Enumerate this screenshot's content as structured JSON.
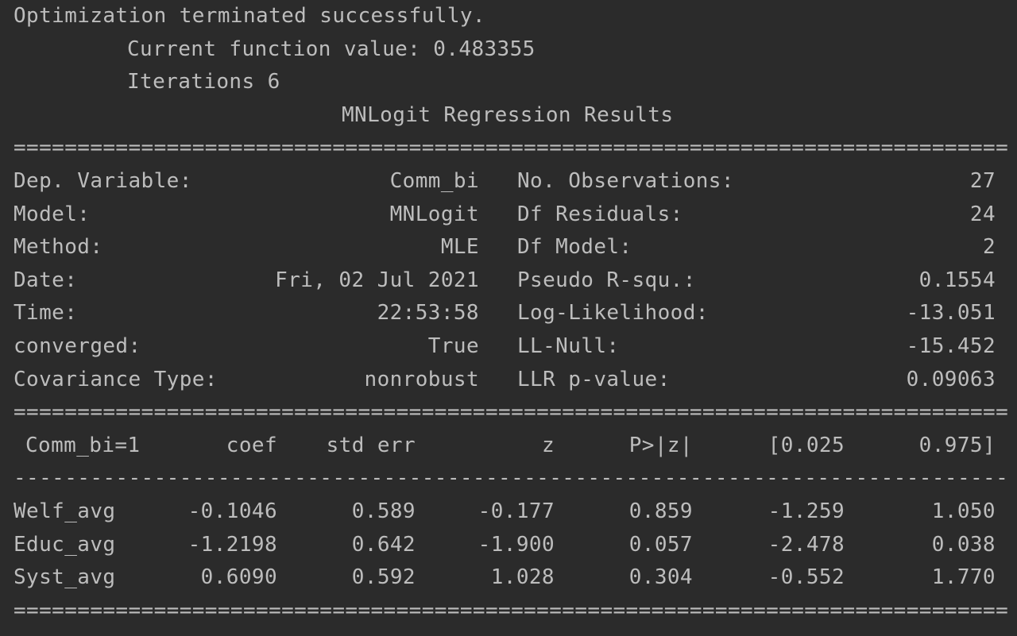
{
  "header": {
    "status": "Optimization terminated successfully.",
    "function_value": "Current function value: 0.483355",
    "iterations": "Iterations 6",
    "title": "MNLogit Regression Results"
  },
  "rules": {
    "double": "==============================================================================",
    "single": "------------------------------------------------------------------------------"
  },
  "summary": [
    {
      "left_label": "Dep. Variable:",
      "left_value": "Comm_bi",
      "right_label": "No. Observations:",
      "right_value": "27"
    },
    {
      "left_label": "Model:",
      "left_value": "MNLogit",
      "right_label": "Df Residuals:",
      "right_value": "24"
    },
    {
      "left_label": "Method:",
      "left_value": "MLE",
      "right_label": "Df Model:",
      "right_value": "2"
    },
    {
      "left_label": "Date:",
      "left_value": "Fri, 02 Jul 2021",
      "right_label": "Pseudo R-squ.:",
      "right_value": "0.1554"
    },
    {
      "left_label": "Time:",
      "left_value": "22:53:58",
      "right_label": "Log-Likelihood:",
      "right_value": "-13.051"
    },
    {
      "left_label": "converged:",
      "left_value": "True",
      "right_label": "LL-Null:",
      "right_value": "-15.452"
    },
    {
      "left_label": "Covariance Type:",
      "left_value": "nonrobust",
      "right_label": "LLR p-value:",
      "right_value": "0.09063"
    }
  ],
  "coef_table": {
    "headers": [
      "Comm_bi=1",
      "coef",
      "std err",
      "z",
      "P>|z|",
      "[0.025",
      "0.975]"
    ],
    "rows": [
      [
        "Welf_avg",
        "-0.1046",
        "0.589",
        "-0.177",
        "0.859",
        "-1.259",
        "1.050"
      ],
      [
        "Educ_avg",
        "-1.2198",
        "0.642",
        "-1.900",
        "0.057",
        "-2.478",
        "0.038"
      ],
      [
        "Syst_avg",
        "0.6090",
        "0.592",
        "1.028",
        "0.304",
        "-0.552",
        "1.770"
      ]
    ]
  }
}
